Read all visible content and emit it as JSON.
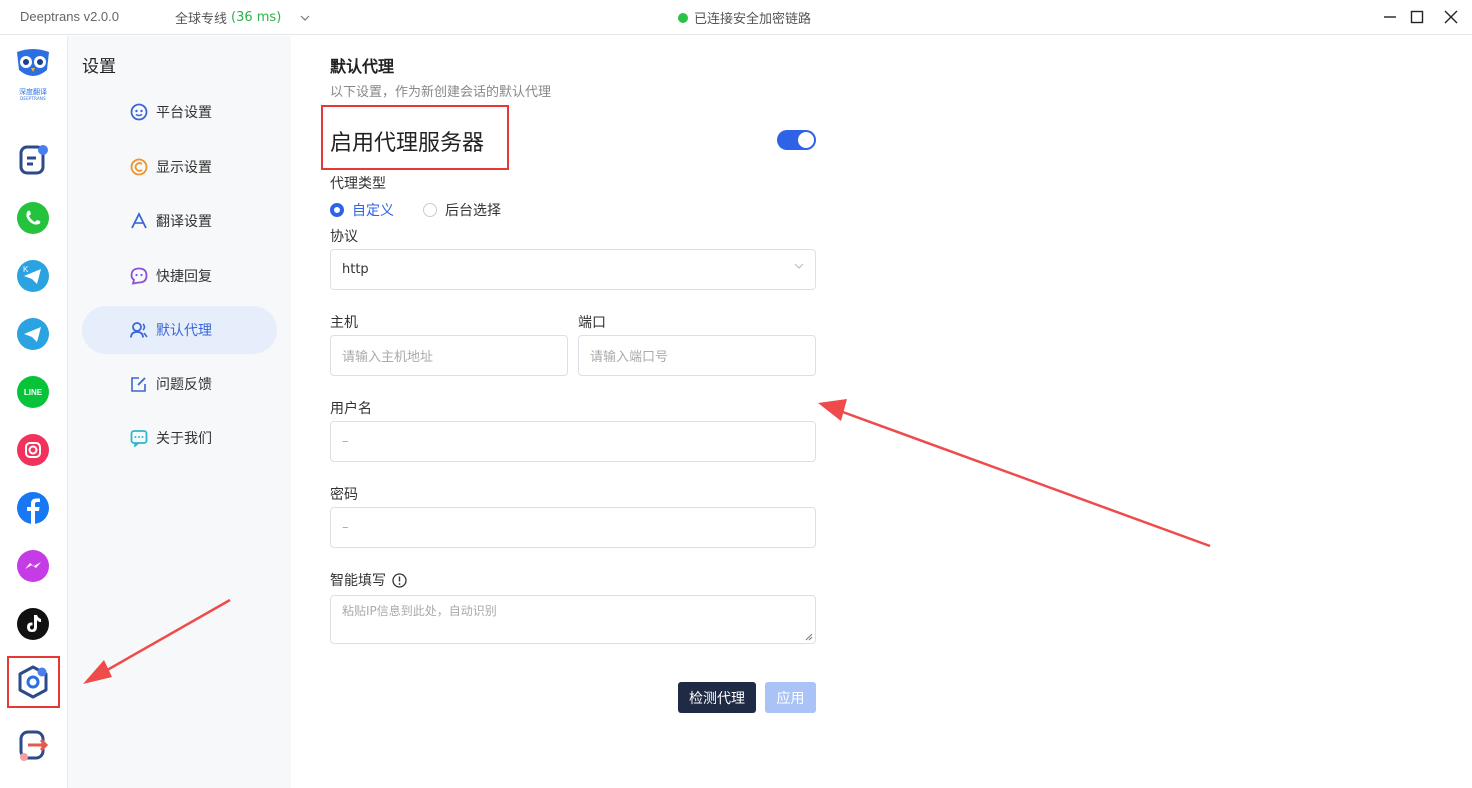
{
  "titlebar": {
    "app_version": "Deeptrans v2.0.0",
    "line_name": "全球专线",
    "latency": "(36 ms)",
    "connection_status": "已连接安全加密链路",
    "status_color": "#2bc24a"
  },
  "brand": {
    "name_cn": "深度翻译",
    "name_en": "DEEPTRANS"
  },
  "rail": {
    "items": [
      {
        "icon": "notes-icon",
        "color": "#2d4a8a"
      },
      {
        "icon": "whatsapp-icon",
        "color": "#25c23e"
      },
      {
        "icon": "telegram-k-icon",
        "color": "#2aa3e0"
      },
      {
        "icon": "telegram-icon",
        "color": "#2aa3e0"
      },
      {
        "icon": "line-icon",
        "color": "#07c339",
        "text": "LINE"
      },
      {
        "icon": "instagram-icon",
        "color": "#f0325c"
      },
      {
        "icon": "facebook-icon",
        "color": "#1877f2"
      },
      {
        "icon": "messenger-icon",
        "color": "#c53be6"
      },
      {
        "icon": "tiktok-icon",
        "color": "#111111"
      },
      {
        "icon": "settings-icon",
        "color": "#2d4a8a"
      },
      {
        "icon": "logout-icon",
        "color": "#2d4a8a"
      }
    ]
  },
  "subnav": {
    "title": "设置",
    "items": [
      {
        "label": "平台设置",
        "icon": "platform-icon",
        "color": "#3a67d6"
      },
      {
        "label": "显示设置",
        "icon": "display-icon",
        "color": "#f0922b"
      },
      {
        "label": "翻译设置",
        "icon": "translate-icon",
        "color": "#3a67d6"
      },
      {
        "label": "快捷回复",
        "icon": "quick-reply-icon",
        "color": "#8a4fd8"
      },
      {
        "label": "默认代理",
        "icon": "proxy-icon",
        "color": "#3a67d6",
        "active": true
      },
      {
        "label": "问题反馈",
        "icon": "feedback-icon",
        "color": "#3a67d6"
      },
      {
        "label": "关于我们",
        "icon": "about-icon",
        "color": "#2fb6c9"
      }
    ]
  },
  "main": {
    "section_title": "默认代理",
    "section_desc": "以下设置，作为新创建会话的默认代理",
    "enable_label": "启用代理服务器",
    "enable_on": true,
    "proxy_type_label": "代理类型",
    "proxy_type_options": [
      {
        "label": "自定义",
        "selected": true
      },
      {
        "label": "后台选择",
        "selected": false
      }
    ],
    "protocol_label": "协议",
    "protocol_value": "http",
    "host_label": "主机",
    "host_placeholder": "请输入主机地址",
    "port_label": "端口",
    "port_placeholder": "请输入端口号",
    "username_label": "用户名",
    "username_placeholder": "–",
    "password_label": "密码",
    "password_placeholder": "–",
    "smart_fill_label": "智能填写",
    "smart_fill_placeholder": "粘贴IP信息到此处，自动识别",
    "check_button": "检测代理",
    "apply_button": "应用",
    "accent_color": "#2e63e8"
  }
}
